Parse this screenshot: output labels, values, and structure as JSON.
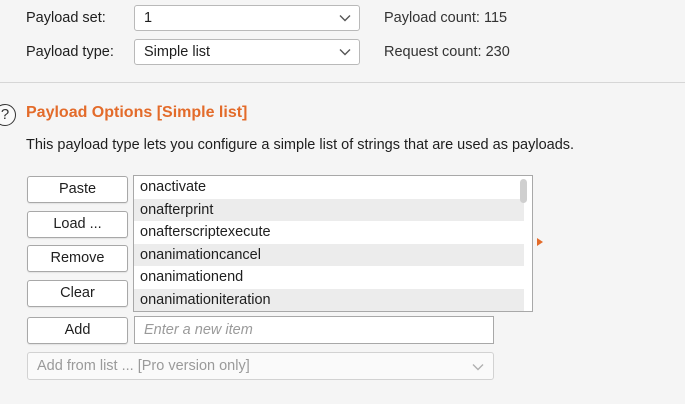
{
  "payload": {
    "set_label": "Payload set:",
    "set_value": "1",
    "type_label": "Payload type:",
    "type_value": "Simple list",
    "count_text": "Payload count: 115",
    "request_text": "Request count: 230"
  },
  "options": {
    "help_glyph": "?",
    "heading": "Payload Options [Simple list]",
    "description": "This payload type lets you configure a simple list of strings that are used as payloads."
  },
  "buttons": {
    "paste": "Paste",
    "load": "Load ...",
    "remove": "Remove",
    "clear": "Clear",
    "add": "Add"
  },
  "list": {
    "items": [
      "onactivate",
      "onafterprint",
      "onafterscriptexecute",
      "onanimationcancel",
      "onanimationend",
      "onanimationiteration"
    ]
  },
  "new_item": {
    "placeholder": "Enter a new item"
  },
  "add_from_list": {
    "value": "Add from list ... [Pro version only]"
  },
  "icons": {
    "chevron": "chevron-down-icon",
    "help": "help-icon",
    "marker": "orange-arrow-icon"
  },
  "colors": {
    "accent": "#e36b2a"
  }
}
